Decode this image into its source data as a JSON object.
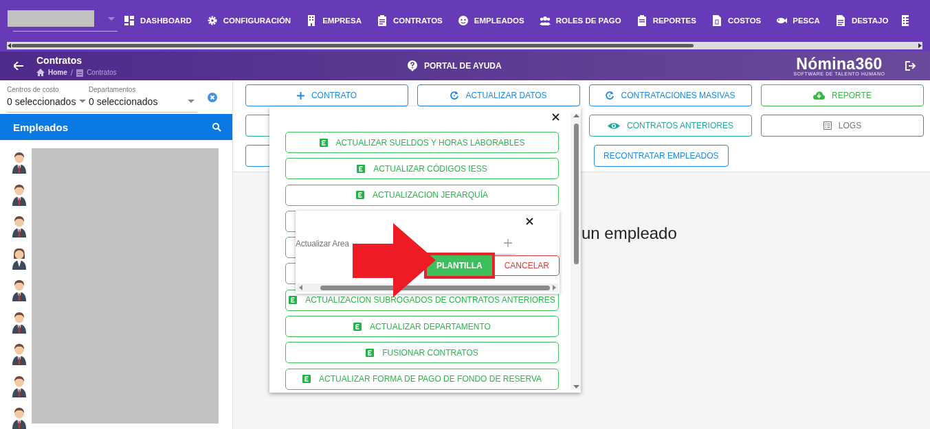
{
  "top_nav": {
    "items": [
      {
        "label": "DASHBOARD"
      },
      {
        "label": "CONFIGURACIÓN"
      },
      {
        "label": "EMPRESA"
      },
      {
        "label": "CONTRATOS"
      },
      {
        "label": "EMPLEADOS"
      },
      {
        "label": "ROLES DE PAGO"
      },
      {
        "label": "REPORTES"
      },
      {
        "label": "COSTOS"
      },
      {
        "label": "PESCA"
      },
      {
        "label": "DESTAJO"
      }
    ]
  },
  "header": {
    "title": "Contratos",
    "breadcrumb": [
      {
        "label": "Home",
        "selected": false
      },
      {
        "label": "Contratos",
        "selected": true
      }
    ],
    "breadcrumb_separator": "/",
    "help": "PORTAL DE AYUDA",
    "logo": "Nómina360",
    "logo_tagline": "SOFTWARE DE TALENTO HUMANO"
  },
  "sidebar": {
    "filters": [
      {
        "label": "Centros de costo",
        "value": "0 seleccionados"
      },
      {
        "label": "Departamentos",
        "value": "0 seleccionados"
      }
    ],
    "list_title": "Empleados",
    "employees": [
      {
        "kind": "male"
      },
      {
        "kind": "male"
      },
      {
        "kind": "male"
      },
      {
        "kind": "female"
      },
      {
        "kind": "male"
      },
      {
        "kind": "male"
      },
      {
        "kind": "male"
      },
      {
        "kind": "male"
      },
      {
        "kind": "male"
      }
    ]
  },
  "actions": [
    [
      {
        "label": "CONTRATO",
        "color": "#1e88e5"
      },
      {
        "label": "ACTUALIZAR DATOS",
        "color": "#1e88e5"
      },
      {
        "label": "CONTRATACIONES MASIVAS",
        "color": "#1e88e5"
      },
      {
        "label": "REPORTE",
        "color": "#3bb54a"
      }
    ],
    [
      {
        "kind": "covered",
        "color": "#26a69a"
      },
      {
        "kind": "hidden"
      },
      {
        "label": "CONTRATOS ANTERIORES",
        "color": "#26a69a"
      },
      {
        "label": "LOGS",
        "color": "#757575"
      }
    ],
    [
      {
        "kind": "covered",
        "color": "#1e88e5"
      },
      {
        "kind": "hidden"
      },
      {
        "label": "RECONTRATAR EMPLEADOS",
        "color": "#1e88e5",
        "kind": "compact"
      }
    ]
  ],
  "empty_message": "un empleado",
  "excel_menu": {
    "items_above_dialog": [
      {
        "label": "ACTUALIZAR SUELDOS Y HORAS LABORABLES"
      },
      {
        "label": "ACTUALIZAR CÓDIGOS IESS"
      },
      {
        "label": "ACTUALIZACION JERARQUÍA"
      }
    ],
    "items_below_dialog": [
      {
        "label": "ACTUALIZACION SUBROGADOS DE CONTRATOS ANTERIORES"
      },
      {
        "label": "ACTUALIZAR DEPARTAMENTO"
      },
      {
        "label": "FUSIONAR CONTRATOS"
      },
      {
        "label": "ACTUALIZAR FORMA DE PAGO DE FONDO DE RESERVA"
      }
    ]
  },
  "upload_dialog": {
    "label": "Actualizar Area",
    "buttons": [
      {
        "label": "PLANTILLA",
        "kind": "primary",
        "highlighted": true
      },
      {
        "label": "CANCELAR",
        "kind": "cancel",
        "highlighted": false
      }
    ]
  }
}
